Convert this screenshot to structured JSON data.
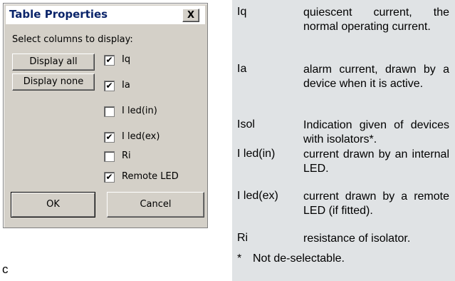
{
  "dialog": {
    "title": "Table Properties",
    "close_label": "X",
    "select_label": "Select columns to display:",
    "display_all_label": "Display all",
    "display_none_label": "Display none",
    "checkboxes": [
      {
        "label": "Iq",
        "checked": true
      },
      {
        "label": "Ia",
        "checked": true
      },
      {
        "label": "I led(in)",
        "checked": false
      },
      {
        "label": "I led(ex)",
        "checked": true
      },
      {
        "label": "Ri",
        "checked": false
      },
      {
        "label": "Remote LED",
        "checked": true
      }
    ],
    "ok_label": "OK",
    "cancel_label": "Cancel"
  },
  "legend": {
    "entries": [
      {
        "term": "Iq",
        "desc": "quiescent current, the normal operating current."
      },
      {
        "term": "Ia",
        "desc": "alarm current, drawn by a device when it is active."
      },
      {
        "term": "Isol",
        "desc": "Indication given of devices with isolators*."
      },
      {
        "term": "I led(in)",
        "desc": "current drawn by an internal LED."
      },
      {
        "term": "I led(ex)",
        "desc": "current drawn by a remote LED (if fitted)."
      },
      {
        "term": "Ri",
        "desc": "resistance of isolator."
      }
    ],
    "footnote_star": "*",
    "footnote_text": "Not de-selectable."
  },
  "caption": "c",
  "colors": {
    "dialog_bg": "#d4d0c8",
    "title_text": "#0a246a",
    "legend_bg": "#e0e3e5"
  }
}
